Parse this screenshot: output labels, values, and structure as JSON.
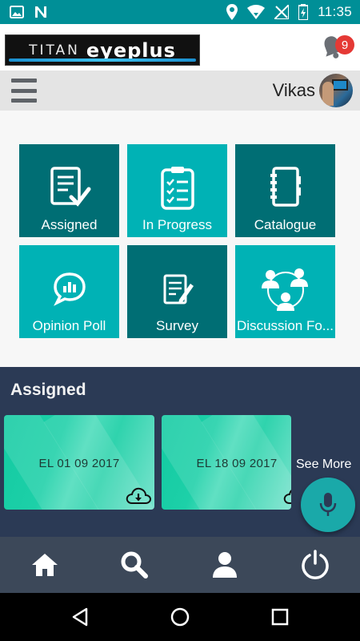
{
  "status_bar": {
    "time": "11:35",
    "icons": [
      "image-icon",
      "n-notification-icon",
      "location-icon",
      "wifi-icon",
      "signal-off-icon",
      "battery-charging-icon"
    ]
  },
  "brand": {
    "logo_word1": "TITAN",
    "logo_word2": "eyeplus",
    "notification_count": "9"
  },
  "user": {
    "name": "Vikas",
    "menu_icon": "menu-icon"
  },
  "tiles": [
    {
      "label": "Assigned",
      "icon": "assigned-icon",
      "color": "#006e74"
    },
    {
      "label": "In Progress",
      "icon": "checklist-icon",
      "color": "#00b2b5"
    },
    {
      "label": "Catalogue",
      "icon": "notebook-icon",
      "color": "#006e74"
    },
    {
      "label": "Opinion Poll",
      "icon": "poll-bubble-icon",
      "color": "#00b2b5"
    },
    {
      "label": "Survey",
      "icon": "survey-icon",
      "color": "#006e74"
    },
    {
      "label": "Discussion Fo...",
      "icon": "discussion-icon",
      "color": "#00b2b5"
    }
  ],
  "assigned": {
    "title": "Assigned",
    "cards": [
      {
        "name": "EL 01 09 2017",
        "icon": "cloud-download-icon"
      },
      {
        "name": "EL 18 09 2017",
        "icon": "cloud-download-icon"
      }
    ],
    "see_more": "See More"
  },
  "mic_button": {
    "icon": "microphone-icon"
  },
  "bottom_nav": [
    {
      "icon": "home-icon"
    },
    {
      "icon": "search-icon"
    },
    {
      "icon": "profile-icon"
    },
    {
      "icon": "power-icon"
    }
  ],
  "system_nav": [
    {
      "icon": "back-icon"
    },
    {
      "icon": "home-circle-icon"
    },
    {
      "icon": "recents-icon"
    }
  ],
  "colors": {
    "status_bar": "#008f97",
    "tile_dark": "#006e74",
    "tile_light": "#00b2b5",
    "section_bg": "#2b3a55",
    "bottom_nav_bg": "#3c4859",
    "badge": "#e53935",
    "fab": "#1aa9a9"
  }
}
